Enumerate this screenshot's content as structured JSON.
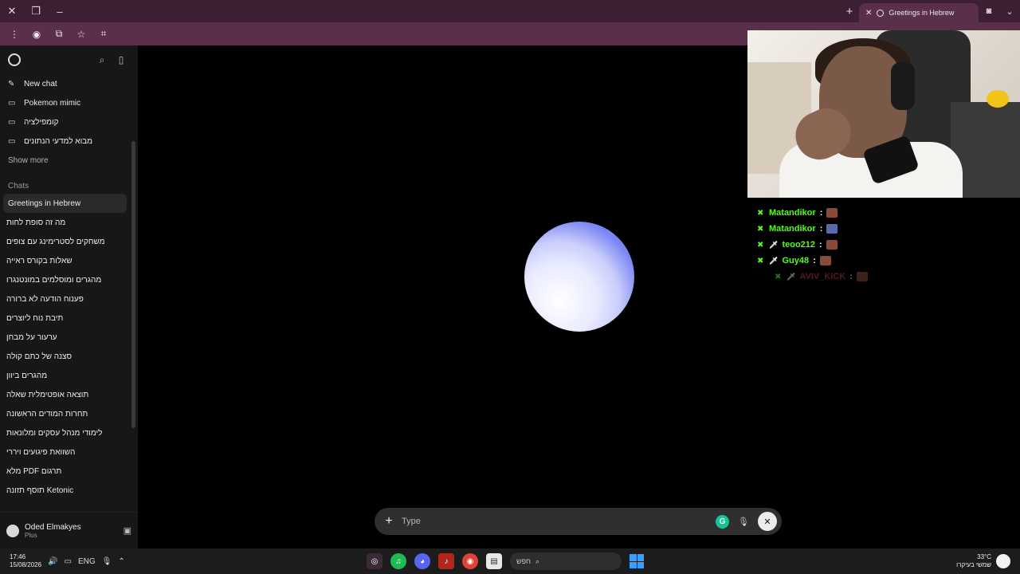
{
  "browser": {
    "tab_title": "Greetings in Hebrew",
    "new_tab": "+",
    "close_tab": "✕"
  },
  "sidebar": {
    "new_chat": "New chat",
    "projects": [
      {
        "label": "Pokemon mimic"
      },
      {
        "label": "קומפילציה"
      },
      {
        "label": "מבוא למדעי הנתונים"
      }
    ],
    "show_more": "Show more",
    "chats_heading": "Chats",
    "chats": [
      {
        "label": "Greetings in Hebrew",
        "active": true
      },
      {
        "label": "מה זה סופת לחות"
      },
      {
        "label": "משחקים לסטרימינג עם צופים"
      },
      {
        "label": "שאלות בקורס ראייה"
      },
      {
        "label": "מהגרים ומוסלמים במונטנגרו"
      },
      {
        "label": "פענוח הודעה לא ברורה"
      },
      {
        "label": "תיבת נוח ליוצרים"
      },
      {
        "label": "ערעור על מבחן"
      },
      {
        "label": "סצנה של כתם קולה"
      },
      {
        "label": "מהגרים ביוון"
      },
      {
        "label": "תוצאה אופטימלית שאלה"
      },
      {
        "label": "תחרות המודים הראשונה"
      },
      {
        "label": "לימודי מנהל עסקים ומלונאות"
      },
      {
        "label": "השוואת פיגועים ויררי"
      },
      {
        "label": "תרגום PDF מלא"
      },
      {
        "label": "Ketonic תוסף תזונה"
      }
    ],
    "user": {
      "name": "Oded Elmakyes",
      "plan": "Plus"
    }
  },
  "composer": {
    "placeholder": "Type",
    "plus": "+",
    "close": "✕"
  },
  "stream_chat": [
    {
      "user": "Matandikor",
      "color": "#53fc18"
    },
    {
      "user": "Matandikor",
      "color": "#53fc18"
    },
    {
      "user": "teoo212",
      "color": "#53fc18"
    },
    {
      "user": "Guy48",
      "color": "#53fc18"
    },
    {
      "user": "AVIV_KICK",
      "color": "#c0324a",
      "faded": true
    }
  ],
  "taskbar": {
    "time": "17:46",
    "date": "15/08/2026",
    "lang": "ENG",
    "search": "חפש",
    "temp": "33°C",
    "weather": "שמשי בעיקרו"
  }
}
